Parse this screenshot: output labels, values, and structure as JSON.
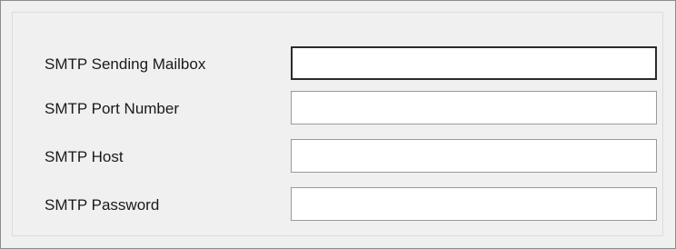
{
  "form": {
    "fields": [
      {
        "label": "SMTP Sending Mailbox",
        "value": "",
        "focused": true
      },
      {
        "label": "SMTP Port Number",
        "value": "",
        "focused": false
      },
      {
        "label": "SMTP Host",
        "value": "",
        "focused": false
      },
      {
        "label": "SMTP Password",
        "value": "",
        "focused": false
      }
    ]
  },
  "colors": {
    "window_background": "#f0f0f0",
    "group_border": "#dcdcdc",
    "input_border": "#9a9a9a",
    "focused_input_border": "#2b2b2b",
    "input_background": "#ffffff",
    "label_text": "#1a1a1a"
  }
}
